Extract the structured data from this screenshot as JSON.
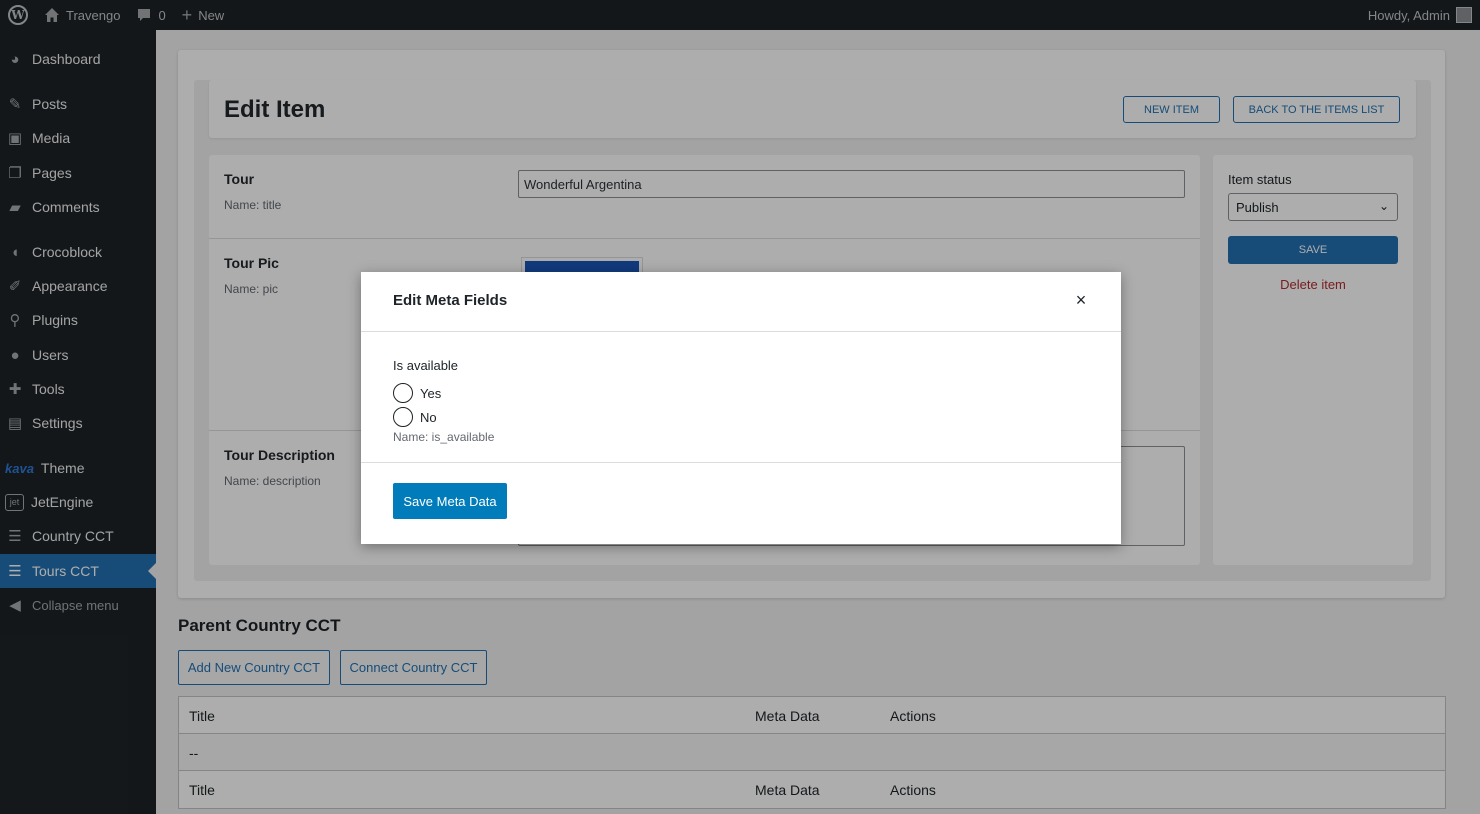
{
  "adminbar": {
    "site_name": "Travengo",
    "comments_count": "0",
    "new_label": "New",
    "greeting": "Howdy, Admin"
  },
  "sidebar": {
    "items": [
      {
        "label": "Dashboard",
        "icon": "dashboard-icon"
      },
      {
        "label": "Posts",
        "icon": "pin-icon"
      },
      {
        "label": "Media",
        "icon": "media-icon"
      },
      {
        "label": "Pages",
        "icon": "pages-icon"
      },
      {
        "label": "Comments",
        "icon": "comment-icon"
      },
      {
        "label": "Crocoblock",
        "icon": "crocoblock-icon"
      },
      {
        "label": "Appearance",
        "icon": "brush-icon"
      },
      {
        "label": "Plugins",
        "icon": "plugin-icon"
      },
      {
        "label": "Users",
        "icon": "user-icon"
      },
      {
        "label": "Tools",
        "icon": "wrench-icon"
      },
      {
        "label": "Settings",
        "icon": "settings-icon"
      },
      {
        "label": "Theme",
        "icon": "kava-logo",
        "logo_text": "kava"
      },
      {
        "label": "JetEngine",
        "icon": "jetengine-icon"
      },
      {
        "label": "Country CCT",
        "icon": "table-icon"
      },
      {
        "label": "Tours CCT",
        "icon": "table-icon"
      },
      {
        "label": "Collapse menu",
        "icon": "collapse-icon"
      }
    ]
  },
  "page": {
    "title": "Edit Item",
    "new_item_label": "NEW ITEM",
    "back_label": "BACK TO THE ITEMS LIST"
  },
  "fields": {
    "tour": {
      "label": "Tour",
      "name": "Name: title",
      "value": "Wonderful Argentina"
    },
    "pic": {
      "label": "Tour Pic",
      "name": "Name: pic"
    },
    "description": {
      "label": "Tour Description",
      "name": "Name: description"
    }
  },
  "status_box": {
    "label": "Item status",
    "selected": "Publish",
    "save_label": "SAVE",
    "delete_label": "Delete item"
  },
  "relation": {
    "section_title": "Parent Country CCT",
    "add_button": "Add New Country CCT",
    "connect_button": "Connect Country CCT",
    "columns": [
      "Title",
      "Meta Data",
      "Actions"
    ],
    "empty_cell": "--"
  },
  "modal": {
    "title": "Edit Meta Fields",
    "close_glyph": "×",
    "field_label": "Is available",
    "options": [
      "Yes",
      "No"
    ],
    "field_name": "Name: is_available",
    "submit_label": "Save Meta Data"
  },
  "colors": {
    "accent": "#2271b1",
    "modal_button": "#007cba",
    "sidebar_bg": "#1d2327",
    "delete": "#b32d2e"
  }
}
